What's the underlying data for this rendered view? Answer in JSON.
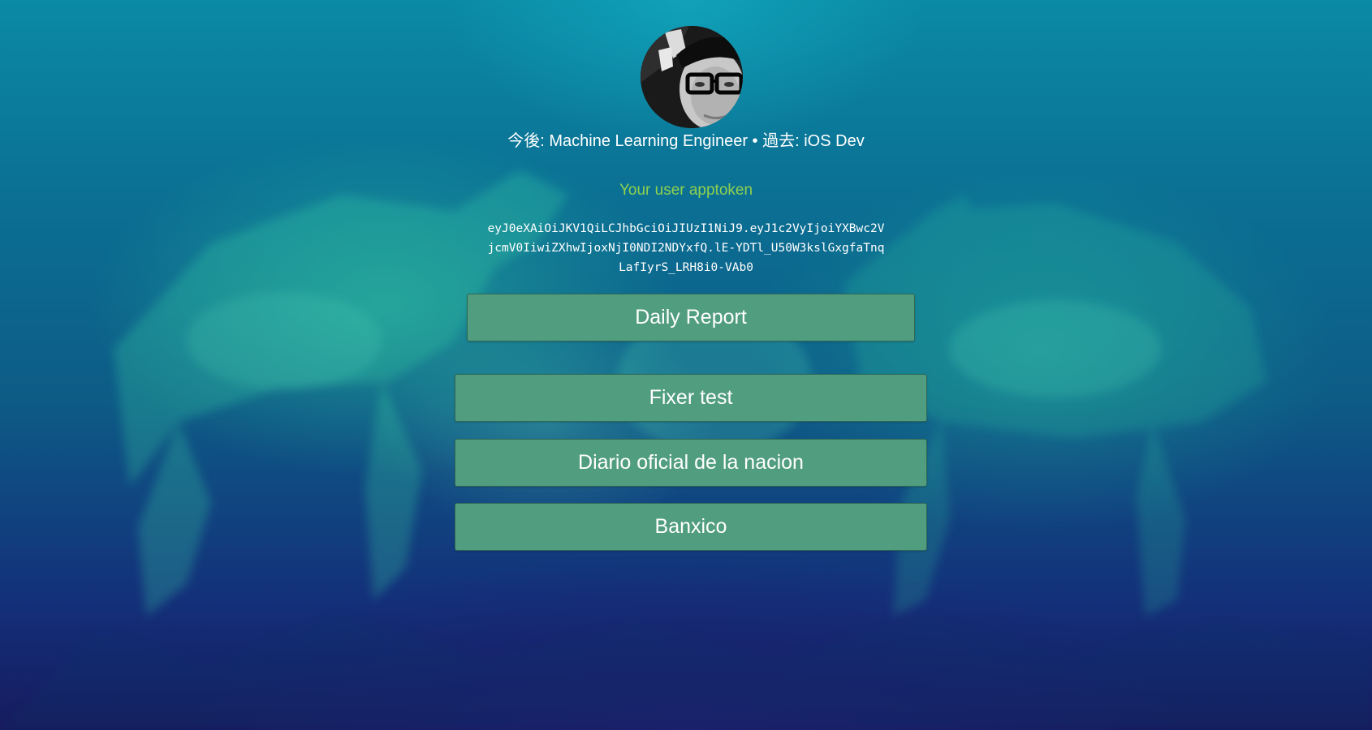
{
  "profile": {
    "avatar_icon": "user-photo-avatar",
    "tagline": "今後: Machine Learning Engineer • 過去: iOS Dev"
  },
  "token_section": {
    "label": "Your user apptoken",
    "token": "eyJ0eXAiOiJKV1QiLCJhbGciOiJIUzI1NiJ9.eyJ1c2VyIjoiYXBwc2VjcmV0IiwiZXhwIjoxNjI0NDI2NDYxfQ.lE-YDTl_U50W3kslGxgfaTnqLafIyrS_LRH8i0-VAb0"
  },
  "buttons": {
    "daily_report": "Daily Report",
    "fixer_test": "Fixer test",
    "diario_oficial": "Diario oficial de la nacion",
    "banxico": "Banxico"
  },
  "colors": {
    "button_bg": "#519d80",
    "token_label": "#8fd14f",
    "text": "#ffffff"
  }
}
